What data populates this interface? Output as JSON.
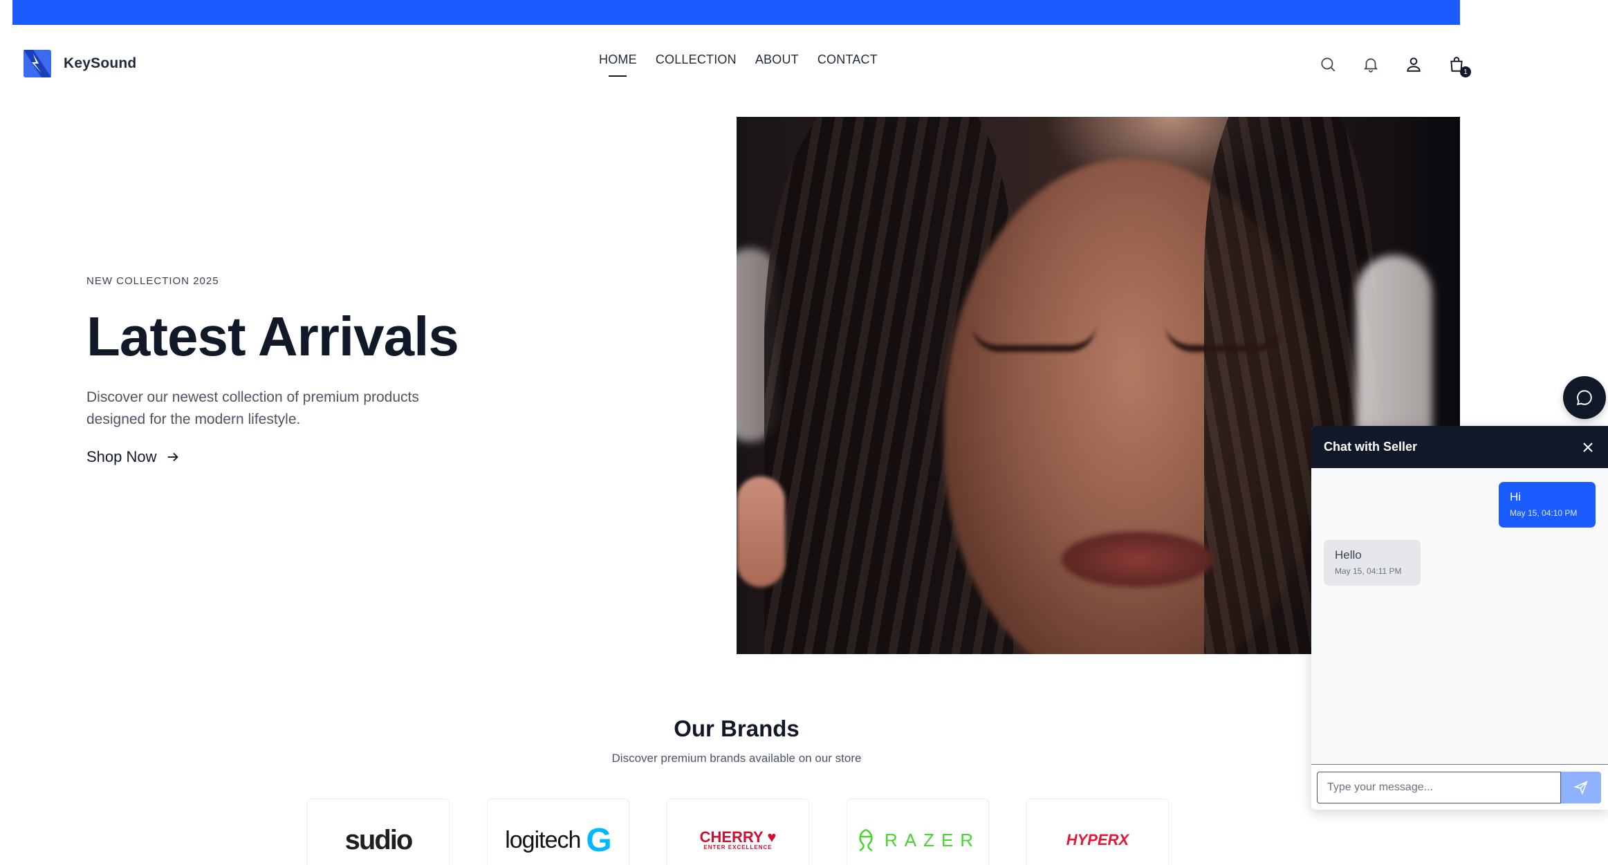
{
  "brand": {
    "name": "KeySound",
    "accent": "#1a5cff"
  },
  "topbar": {
    "text": ""
  },
  "nav": {
    "items": [
      {
        "label": "HOME",
        "active": true
      },
      {
        "label": "COLLECTION"
      },
      {
        "label": "ABOUT"
      },
      {
        "label": "CONTACT"
      }
    ]
  },
  "header_icons": [
    "search-icon",
    "bell-icon",
    "user-icon",
    "cart-icon"
  ],
  "cart": {
    "count": "1"
  },
  "hero": {
    "eyebrow": "NEW COLLECTION 2025",
    "title": "Latest Arrivals",
    "description": "Discover our newest collection of premium products designed for the modern lifestyle.",
    "cta": "Shop Now"
  },
  "brands": {
    "title": "Our Brands",
    "subtitle": "Discover premium brands available on our store",
    "items": [
      "sudio",
      "logitech",
      "CHERRY",
      "RAZER",
      "HYPERX"
    ]
  },
  "chat": {
    "title": "Chat with Seller",
    "messages": [
      {
        "direction": "out",
        "text": "Hi",
        "time": "May 15, 04:10 PM"
      },
      {
        "direction": "in",
        "text": "Hello",
        "time": "May 15, 04:11 PM"
      }
    ],
    "input_placeholder": "Type your message..."
  }
}
